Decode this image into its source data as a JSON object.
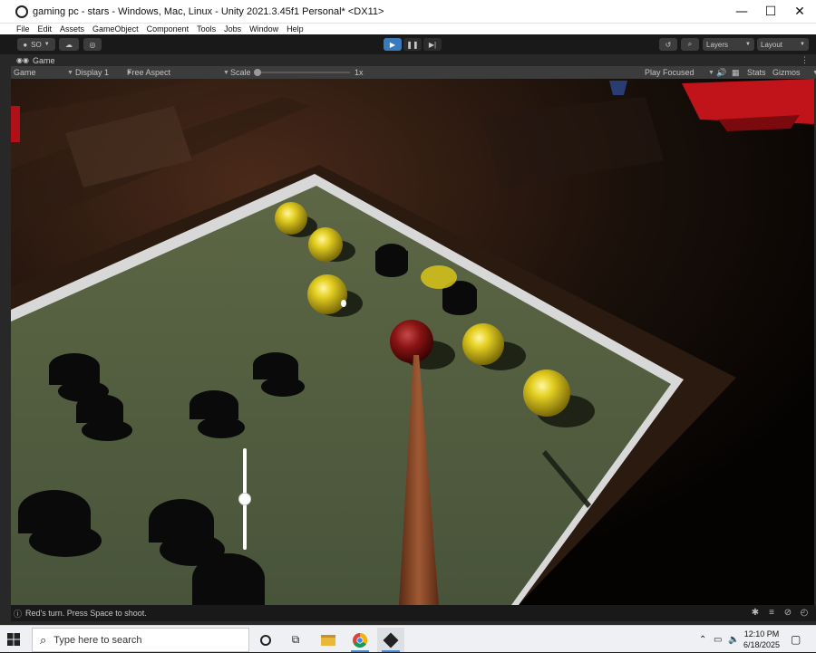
{
  "window": {
    "title": "gaming pc - stars - Windows, Mac, Linux - Unity 2021.3.45f1 Personal* <DX11>",
    "controls": {
      "minimize": "—",
      "maximize": "☐",
      "close": "✕"
    }
  },
  "menu": [
    "File",
    "Edit",
    "Assets",
    "GameObject",
    "Component",
    "Tools",
    "Jobs",
    "Window",
    "Help"
  ],
  "toolbar": {
    "account_label": "SO",
    "layers_label": "Layers",
    "layout_label": "Layout"
  },
  "game_tab": {
    "label": "Game"
  },
  "game_bar": {
    "view_select": "Game",
    "display_select": "Display 1",
    "aspect_select": "Free Aspect",
    "scale_label": "Scale",
    "scale_value": "1x",
    "play_mode": "Play Focused",
    "stats_label": "Stats",
    "gizmos_label": "Gizmos"
  },
  "game": {
    "power_slider_value": 0.5,
    "colors": {
      "yellow_ball": "#d8c41a",
      "red_ball": "#8a1010",
      "felt": "#4f5a3d",
      "rail": "#d0d0d0",
      "cue": "#8a4a2a"
    }
  },
  "status": {
    "text": "Red's turn. Press Space to shoot."
  },
  "taskbar": {
    "search_placeholder": "Type here to search",
    "time": "12:10 PM",
    "date": "6/18/2025",
    "apps": [
      "cortana-icon",
      "task-view-icon",
      "file-explorer-icon",
      "chrome-icon",
      "unity-icon"
    ]
  }
}
